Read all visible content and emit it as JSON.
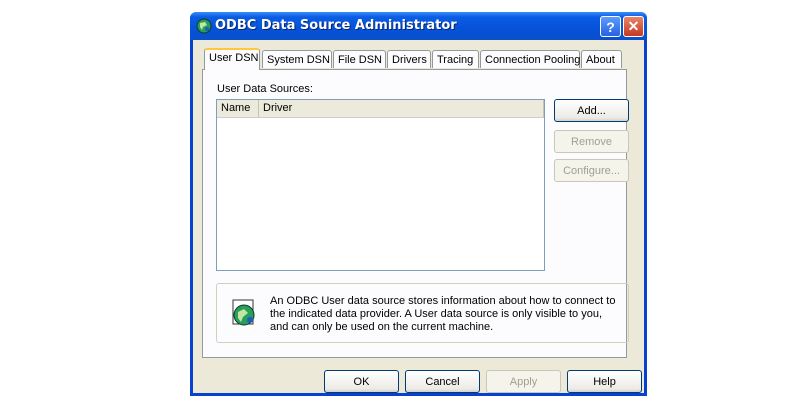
{
  "window": {
    "title": "ODBC Data Source Administrator",
    "help_label": "?",
    "close_label": "✕"
  },
  "tabs": [
    {
      "label": "User DSN",
      "active": true
    },
    {
      "label": "System DSN"
    },
    {
      "label": "File DSN"
    },
    {
      "label": "Drivers"
    },
    {
      "label": "Tracing"
    },
    {
      "label": "Connection Pooling"
    },
    {
      "label": "About"
    }
  ],
  "panel": {
    "list_label": "User Data Sources:",
    "columns": [
      "Name",
      "Driver"
    ],
    "buttons": {
      "add": "Add...",
      "remove": "Remove",
      "configure": "Configure..."
    },
    "info_text": "An ODBC User data source stores information about how to connect to the indicated data provider.  A User data source is only visible to you, and can only be used on the current machine."
  },
  "footer": {
    "ok": "OK",
    "cancel": "Cancel",
    "apply": "Apply",
    "help": "Help"
  },
  "colors": {
    "titlebar": "#0a5de3",
    "face": "#ece9d8",
    "tab_highlight": "#ffc83c"
  }
}
